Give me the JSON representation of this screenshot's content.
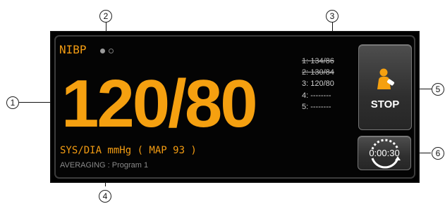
{
  "callouts": [
    "1",
    "2",
    "3",
    "4",
    "5",
    "6"
  ],
  "panel": {
    "title": "NIBP",
    "reading": "120/80",
    "units_line": "SYS/DIA mmHg ( MAP 93 )",
    "mode_line": "AVERAGING : Program 1",
    "history": [
      {
        "text": "1: 134/86",
        "struck": true
      },
      {
        "text": "2: 130/84",
        "struck": true
      },
      {
        "text": "3: 120/80",
        "struck": false
      },
      {
        "text": "4: --------",
        "struck": false
      },
      {
        "text": "5: --------",
        "struck": false
      }
    ],
    "stop_label": "STOP",
    "timer_label": "0:00:30"
  },
  "colors": {
    "accent": "#f5a010",
    "panel_bg": "#000000",
    "button_bg": "#3a3a3a",
    "muted_text": "#8a8a8a"
  },
  "icons": {
    "stop": "person-cuff-icon",
    "timer": "interval-cycle-icon",
    "page_indicator": "page-dots-icon"
  }
}
